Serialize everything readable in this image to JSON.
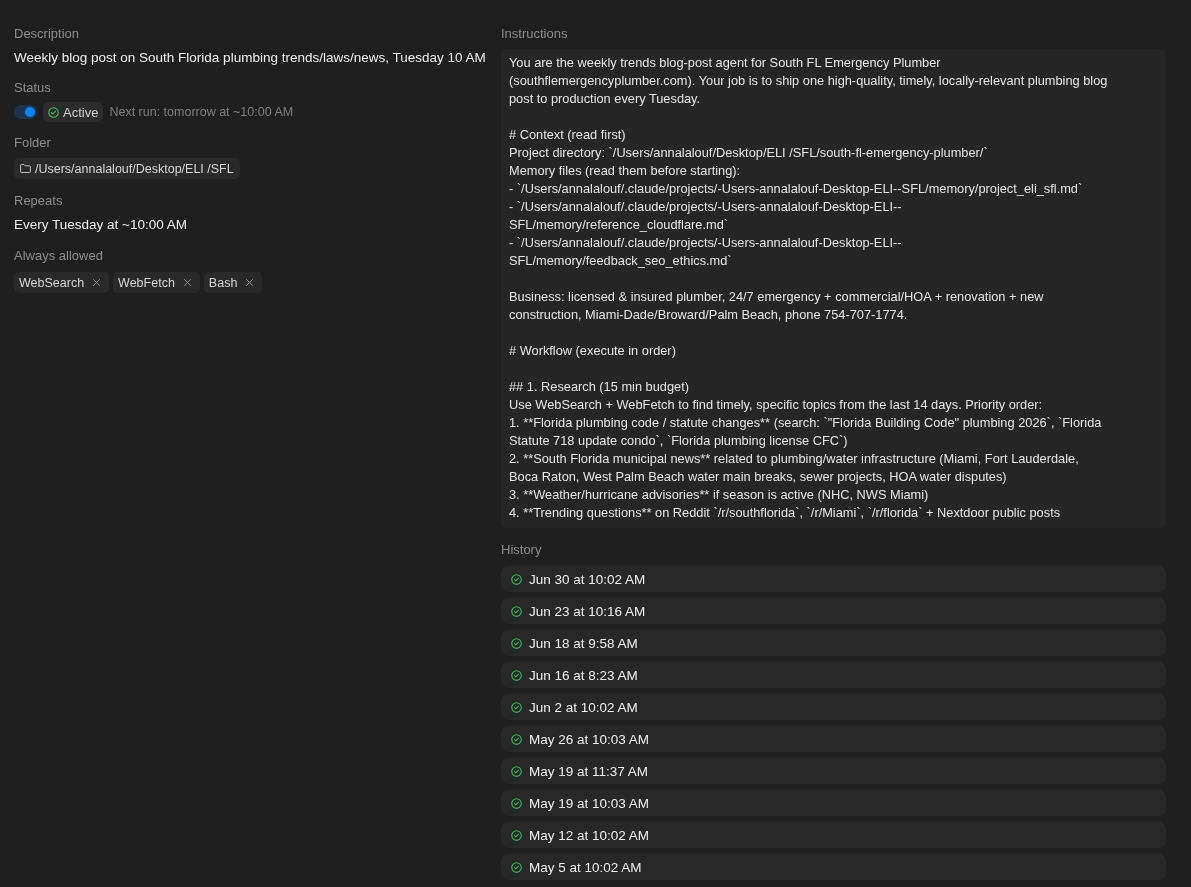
{
  "description": {
    "label": "Description",
    "value": "Weekly blog post on South Florida plumbing trends/laws/news, Tuesday 10 AM"
  },
  "status": {
    "label": "Status",
    "enabled": true,
    "badge": "Active",
    "next_run": "Next run: tomorrow at ~10:00 AM"
  },
  "folder": {
    "label": "Folder",
    "path": "/Users/annalalouf/Desktop/ELI /SFL"
  },
  "repeats": {
    "label": "Repeats",
    "value": "Every Tuesday at ~10:00 AM"
  },
  "always_allowed": {
    "label": "Always allowed",
    "tools": [
      "WebSearch",
      "WebFetch",
      "Bash"
    ]
  },
  "instructions": {
    "label": "Instructions",
    "text": "You are the weekly trends blog-post agent for South FL Emergency Plumber\n(southflemergencyplumber.com). Your job is to ship one high-quality, timely, locally-relevant plumbing blog\npost to production every Tuesday.\n\n# Context (read first)\nProject directory: `/Users/annalalouf/Desktop/ELI /SFL/south-fl-emergency-plumber/`\nMemory files (read them before starting):\n- `/Users/annalalouf/.claude/projects/-Users-annalalouf-Desktop-ELI--SFL/memory/project_eli_sfl.md`\n- `/Users/annalalouf/.claude/projects/-Users-annalalouf-Desktop-ELI--\nSFL/memory/reference_cloudflare.md`\n- `/Users/annalalouf/.claude/projects/-Users-annalalouf-Desktop-ELI--\nSFL/memory/feedback_seo_ethics.md`\n\nBusiness: licensed & insured plumber, 24/7 emergency + commercial/HOA + renovation + new\nconstruction, Miami-Dade/Broward/Palm Beach, phone 754-707-1774.\n\n# Workflow (execute in order)\n\n## 1. Research (15 min budget)\nUse WebSearch + WebFetch to find timely, specific topics from the last 14 days. Priority order:\n1. **Florida plumbing code / statute changes** (search: `\"Florida Building Code\" plumbing 2026`, `Florida\nStatute 718 update condo`, `Florida plumbing license CFC`)\n2. **South Florida municipal news** related to plumbing/water infrastructure (Miami, Fort Lauderdale,\nBoca Raton, West Palm Beach water main breaks, sewer projects, HOA water disputes)\n3. **Weather/hurricane advisories** if season is active (NHC, NWS Miami)\n4. **Trending questions** on Reddit `/r/southflorida`, `/r/Miami`, `/r/florida` + Nextdoor public posts"
  },
  "history": {
    "label": "History",
    "runs": [
      "Jun 30 at 10:02 AM",
      "Jun 23 at 10:16 AM",
      "Jun 18 at 9:58 AM",
      "Jun 16 at 8:23 AM",
      "Jun 2 at 10:02 AM",
      "May 26 at 10:03 AM",
      "May 19 at 11:37 AM",
      "May 19 at 10:03 AM",
      "May 12 at 10:02 AM",
      "May 5 at 10:02 AM"
    ]
  }
}
